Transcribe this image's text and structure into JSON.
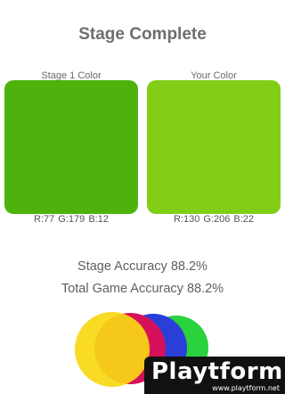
{
  "screen": {
    "title": "Stage Complete",
    "stage_color": {
      "label": "Stage 1 Color",
      "rgb_text": "R:77  G:179  B:12",
      "hex": "#4db30c"
    },
    "your_color": {
      "label": "Your Color",
      "rgb_text": "R:130  G:206  B:22",
      "hex": "#82ce16"
    },
    "stage_accuracy": "Stage Accuracy 88.2%",
    "total_accuracy": "Total Game Accuracy 88.2%"
  },
  "decor": {
    "circle_colors": [
      "#f8d814",
      "#d6105a",
      "#2a3fd8",
      "#2ad23e"
    ],
    "icon": "color-circles-icon"
  },
  "watermark": {
    "brand": "Playtform",
    "url": "www.playtform.net"
  }
}
